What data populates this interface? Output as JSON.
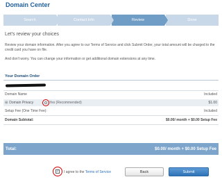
{
  "page": {
    "title": "Domain Center"
  },
  "steps": [
    "Search",
    "Contact Info",
    "Review",
    "Done"
  ],
  "active_step": "Review",
  "intro": {
    "heading": "Let's review your choices",
    "p1": "Review your domain information. After you agree to our Terms of Service and click Submit Order, your total amount will be charged to the credit card you have on file.",
    "p2": "And don't worry. You can change your information or get additional domain extensions at any time."
  },
  "order": {
    "heading": "Your Domain Order",
    "rows": [
      {
        "label": "Domain Name",
        "value": "Included"
      },
      {
        "label": "Domain Privacy",
        "option": "Yes (Recommended)",
        "value": "$1.00"
      },
      {
        "label": "Setup Fee (One Time Fee):",
        "value": "Included"
      }
    ],
    "subtotal_label": "Domain Subtotal:",
    "subtotal_value": "$0.00/ month + $0.00 Setup Fee"
  },
  "total": {
    "label": "Total:",
    "value": "$0.00/ month + $0.00 Setup Fee"
  },
  "agree": {
    "prefix": "I agree to the",
    "link": "Terms of Service",
    "checked": true
  },
  "buttons": {
    "back": "Back",
    "submit": "Submit"
  },
  "colors": {
    "brand": "#1f5f9f",
    "active_step": "#6f9dc5",
    "inactive_step": "#c9d8e8",
    "total_bar": "#7da5cc",
    "highlight": "#d30000"
  }
}
